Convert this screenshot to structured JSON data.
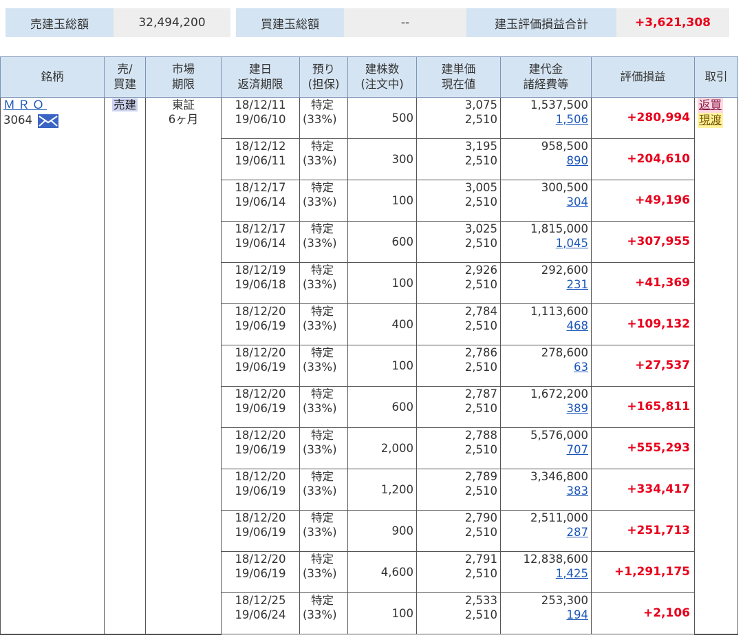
{
  "summary": {
    "sell_total_label": "売建玉総額",
    "sell_total_value": "32,494,200",
    "buy_total_label": "買建玉総額",
    "buy_total_value": "--",
    "pl_total_label": "建玉評価損益合計",
    "pl_total_value": "+3,621,308"
  },
  "headers": {
    "stock": "銘柄",
    "side_1": "売/",
    "side_2": "買建",
    "market_1": "市場",
    "market_2": "期限",
    "date_1": "建日",
    "date_2": "返済期限",
    "deposit_1": "預り",
    "deposit_2": "(担保)",
    "qty_1": "建株数",
    "qty_2": "(注文中)",
    "price_1": "建単価",
    "price_2": "現在値",
    "amount_1": "建代金",
    "amount_2": "諸経費等",
    "pl": "評価損益",
    "trade": "取引"
  },
  "stock": {
    "name": "ＭＲＯ",
    "code": "3064",
    "side": "売建",
    "market": "東証",
    "term": "6ヶ月",
    "action_buyback": "返買",
    "action_delivery": "現渡"
  },
  "rows": [
    {
      "open_date": "18/12/11",
      "due_date": "19/06/10",
      "deposit": "特定",
      "margin": "(33%)",
      "qty": "500",
      "open_price": "3,075",
      "current_price": "2,510",
      "amount": "1,537,500",
      "fees": "1,506",
      "pl": "+280,994"
    },
    {
      "open_date": "18/12/12",
      "due_date": "19/06/11",
      "deposit": "特定",
      "margin": "(33%)",
      "qty": "300",
      "open_price": "3,195",
      "current_price": "2,510",
      "amount": "958,500",
      "fees": "890",
      "pl": "+204,610"
    },
    {
      "open_date": "18/12/17",
      "due_date": "19/06/14",
      "deposit": "特定",
      "margin": "(33%)",
      "qty": "100",
      "open_price": "3,005",
      "current_price": "2,510",
      "amount": "300,500",
      "fees": "304",
      "pl": "+49,196"
    },
    {
      "open_date": "18/12/17",
      "due_date": "19/06/14",
      "deposit": "特定",
      "margin": "(33%)",
      "qty": "600",
      "open_price": "3,025",
      "current_price": "2,510",
      "amount": "1,815,000",
      "fees": "1,045",
      "pl": "+307,955"
    },
    {
      "open_date": "18/12/19",
      "due_date": "19/06/18",
      "deposit": "特定",
      "margin": "(33%)",
      "qty": "100",
      "open_price": "2,926",
      "current_price": "2,510",
      "amount": "292,600",
      "fees": "231",
      "pl": "+41,369"
    },
    {
      "open_date": "18/12/20",
      "due_date": "19/06/19",
      "deposit": "特定",
      "margin": "(33%)",
      "qty": "400",
      "open_price": "2,784",
      "current_price": "2,510",
      "amount": "1,113,600",
      "fees": "468",
      "pl": "+109,132"
    },
    {
      "open_date": "18/12/20",
      "due_date": "19/06/19",
      "deposit": "特定",
      "margin": "(33%)",
      "qty": "100",
      "open_price": "2,786",
      "current_price": "2,510",
      "amount": "278,600",
      "fees": "63",
      "pl": "+27,537"
    },
    {
      "open_date": "18/12/20",
      "due_date": "19/06/19",
      "deposit": "特定",
      "margin": "(33%)",
      "qty": "600",
      "open_price": "2,787",
      "current_price": "2,510",
      "amount": "1,672,200",
      "fees": "389",
      "pl": "+165,811"
    },
    {
      "open_date": "18/12/20",
      "due_date": "19/06/19",
      "deposit": "特定",
      "margin": "(33%)",
      "qty": "2,000",
      "open_price": "2,788",
      "current_price": "2,510",
      "amount": "5,576,000",
      "fees": "707",
      "pl": "+555,293"
    },
    {
      "open_date": "18/12/20",
      "due_date": "19/06/19",
      "deposit": "特定",
      "margin": "(33%)",
      "qty": "1,200",
      "open_price": "2,789",
      "current_price": "2,510",
      "amount": "3,346,800",
      "fees": "383",
      "pl": "+334,417"
    },
    {
      "open_date": "18/12/20",
      "due_date": "19/06/19",
      "deposit": "特定",
      "margin": "(33%)",
      "qty": "900",
      "open_price": "2,790",
      "current_price": "2,510",
      "amount": "2,511,000",
      "fees": "287",
      "pl": "+251,713"
    },
    {
      "open_date": "18/12/20",
      "due_date": "19/06/19",
      "deposit": "特定",
      "margin": "(33%)",
      "qty": "4,600",
      "open_price": "2,791",
      "current_price": "2,510",
      "amount": "12,838,600",
      "fees": "1,425",
      "pl": "+1,291,175"
    },
    {
      "open_date": "18/12/25",
      "due_date": "19/06/24",
      "deposit": "特定",
      "margin": "(33%)",
      "qty": "100",
      "open_price": "2,533",
      "current_price": "2,510",
      "amount": "253,300",
      "fees": "194",
      "pl": "+2,106"
    }
  ],
  "icons": {
    "mail": "mail-icon"
  },
  "colors": {
    "header_bg": "#d5e4f2",
    "profit": "#e8001b",
    "link": "#1a56b8"
  }
}
